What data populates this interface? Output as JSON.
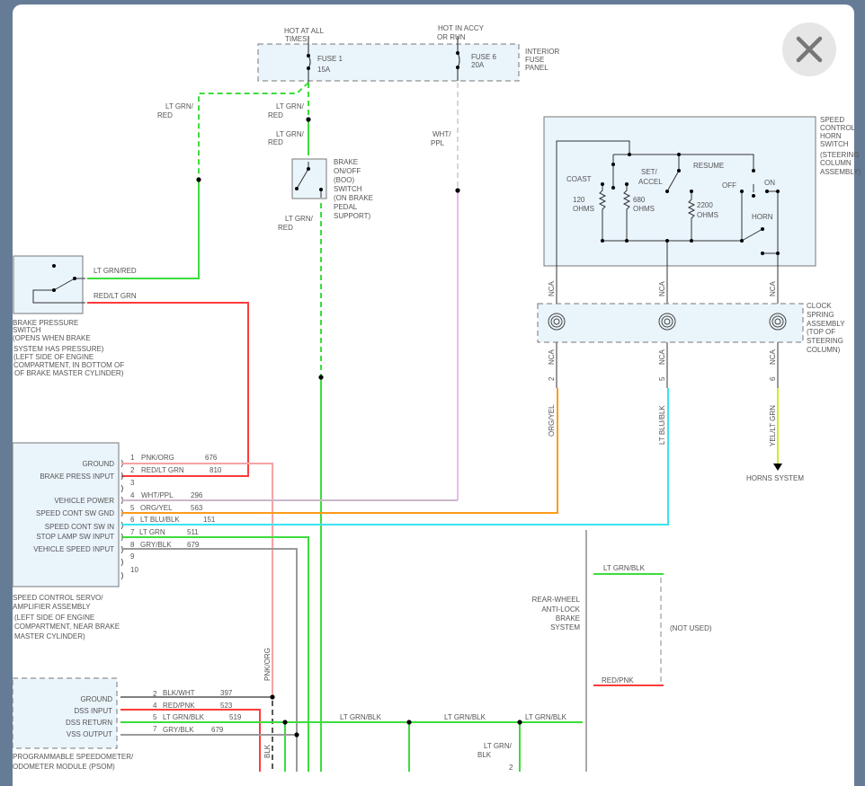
{
  "close_button": {
    "icon": "close-icon"
  },
  "colors": {
    "lt_grn": "#3ddc3d",
    "red": "#ff3b3b",
    "pnk_org": "#f6a3a3",
    "org_yel": "#ff9a1a",
    "lt_blu": "#3be3f2",
    "yel_lt_grn": "#cdea2e",
    "gry": "#9a9a9a",
    "wht_ppl": "#c9b7c9",
    "ppl": "#e7a4e4",
    "blk": "#222222",
    "box": "#eaf4fb"
  },
  "fuse_panel": {
    "hot_all_1": "HOT AT ALL",
    "hot_all_2": "TIMES",
    "fuse1": "FUSE 1",
    "fuse1_amp": "15A",
    "hot_accy_1": "HOT IN ACCY",
    "hot_accy_2": "OR RUN",
    "fuse6": "FUSE 6",
    "fuse6_amp": "20A",
    "name": [
      "INTERIOR",
      "FUSE",
      "PANEL"
    ]
  },
  "wires": {
    "ltgrn_red_a": [
      "LT GRN/",
      "RED"
    ],
    "ltgrn_red_b": [
      "LT GRN/",
      "RED"
    ],
    "ltgrn_red_c": [
      "LT GRN/",
      "RED"
    ],
    "ltgrn_red_d": [
      "LT GRN/",
      "RED"
    ],
    "wht_ppl": [
      "WHT/",
      "PPL"
    ],
    "ltgrn_red_h": "LT GRN/RED",
    "red_ltgrn_h": "RED/LT GRN"
  },
  "boo_switch": [
    "BRAKE",
    "ON/OFF",
    "(BOO)",
    "SWITCH",
    "(ON BRAKE",
    "PEDAL",
    "SUPPORT)"
  ],
  "brake_pressure_switch": [
    "BRAKE PRESSURE",
    "SWITCH",
    "(OPENS WHEN BRAKE",
    "SYSTEM HAS PRESSURE)",
    "(LEFT SIDE OF ENGINE",
    "COMPARTMENT, IN BOTTOM OF",
    "OF BRAKE MASTER CYLINDER)"
  ],
  "servo": {
    "pins": [
      "GROUND",
      "BRAKE PRESS INPUT",
      "VEHICLE POWER",
      "SPEED CONT SW GND",
      "SPEED CONT SW IN",
      "STOP LAMP SW INPUT",
      "VEHICLE SPEED INPUT"
    ],
    "pin_numbers": [
      "1",
      "2",
      "3",
      "4",
      "5",
      "6",
      "7",
      "8",
      "9",
      "10"
    ],
    "wires": [
      {
        "color": "PNK/ORG",
        "circuit": "676"
      },
      {
        "color": "RED/LT GRN",
        "circuit": "810"
      },
      {
        "color": "WHT/PPL",
        "circuit": "296"
      },
      {
        "color": "ORG/YEL",
        "circuit": "563"
      },
      {
        "color": "LT BLU/BLK",
        "circuit": "151"
      },
      {
        "color": "LT GRN",
        "circuit": "511"
      },
      {
        "color": "GRY/BLK",
        "circuit": "679"
      }
    ],
    "name": [
      "SPEED CONTROL SERVO/",
      "AMPLIFIER ASSEMBLY",
      "(LEFT SIDE OF ENGINE",
      "COMPARTMENT, NEAR BRAKE",
      "MASTER CYLINDER)"
    ]
  },
  "horn_switch": {
    "coast": "COAST",
    "r120": [
      "120",
      "OHMS"
    ],
    "r680": [
      "680",
      "OHMS"
    ],
    "set": [
      "SET/",
      "ACCEL"
    ],
    "resume": "RESUME",
    "r2200": [
      "2200",
      "OHMS"
    ],
    "off": "OFF",
    "on": "ON",
    "horn": "HORN",
    "name": [
      "SPEED",
      "CONTROL",
      "HORN",
      "SWITCH",
      "(STEERING",
      "COLUMN",
      "ASSEMBLY)"
    ]
  },
  "clock_spring": {
    "nca": "NCA",
    "name": [
      "CLOCK",
      "SPRING",
      "ASSEMBLY",
      "(TOP OF",
      "STEERING",
      "COLUMN)"
    ],
    "pins": [
      "2",
      "5",
      "6"
    ],
    "wires": [
      "ORG/YEL",
      "LT BLU/BLK",
      "YEL/LT GRN"
    ],
    "horns": "HORNS SYSTEM"
  },
  "abs": {
    "name": [
      "REAR-WHEEL",
      "ANTI-LOCK",
      "BRAKE",
      "SYSTEM"
    ],
    "w1": "LT GRN/BLK",
    "w2": "RED/PNK",
    "not_used": "(NOT USED)"
  },
  "psom": {
    "pins": [
      "GROUND",
      "DSS INPUT",
      "DSS RETURN",
      "VSS OUTPUT"
    ],
    "pin_numbers": [
      "2",
      "4",
      "5",
      "7"
    ],
    "wires": [
      {
        "color": "BLK/WHT",
        "circuit": "397"
      },
      {
        "color": "RED/PNK",
        "circuit": "523"
      },
      {
        "color": "LT GRN/BLK",
        "circuit": "519"
      },
      {
        "color": "GRY/BLK",
        "circuit": "679"
      }
    ],
    "name": [
      "PROGRAMMABLE SPEEDOMETER/",
      "ODOMETER MODULE (PSOM)"
    ],
    "bus": [
      "LT GRN/BLK",
      "LT GRN/BLK",
      "LT GRN/BLK"
    ],
    "pnk_org": "PNK/ORG",
    "blk": "BLK",
    "drop": [
      "LT GRN/",
      "BLK"
    ],
    "drop_pin": "2"
  }
}
